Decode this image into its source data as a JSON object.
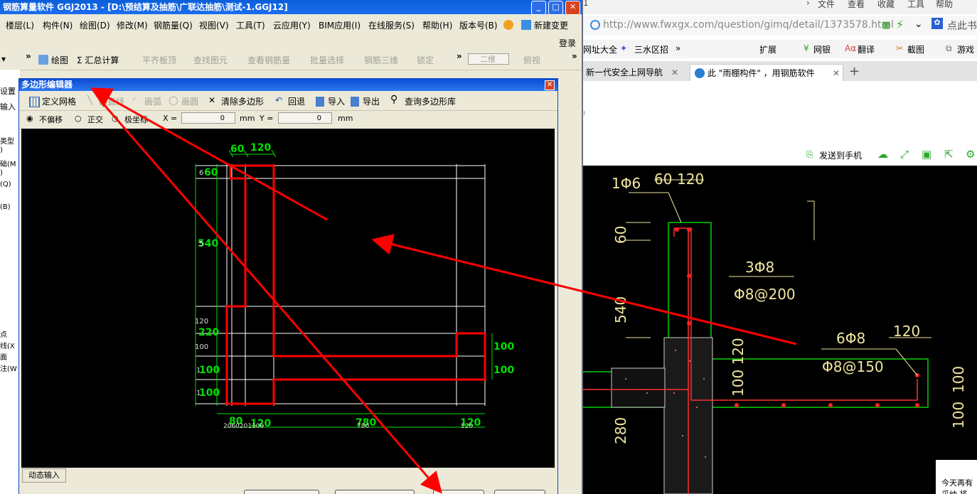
{
  "app": {
    "title": "钢筋算量软件 GGJ2013 - [D:\\预结算及抽筋\\广联达抽筋\\测试-1.GGJ12]",
    "window_buttons": [
      "_",
      "□",
      "✕"
    ],
    "menu": [
      "楼层(L)",
      "构件(N)",
      "绘图(D)",
      "修改(M)",
      "钢筋量(Q)",
      "视图(V)",
      "工具(T)",
      "云应用(Y)",
      "BIM应用(I)",
      "在线服务(S)",
      "帮助(H)",
      "版本号(B)",
      "新建变更"
    ],
    "login": "登录",
    "toolbar": {
      "draw": "绘图",
      "summary": "Σ 汇总计算",
      "flat_top": "平齐板顶",
      "find_element": "查找图元",
      "view_rebar": "查看钢筋量",
      "batch_select": "批量选择",
      "rebar_3d": "钢筋三维",
      "lock": "锁定",
      "view_mode": "二维",
      "top_view": "俯视"
    },
    "left_strip": {
      "settings": "设置",
      "input": "输入",
      "items": [
        "类型",
        ")",
        "础(M",
        ")",
        "(Q)",
        "(B)",
        "点",
        "线(X",
        "面",
        "注(W"
      ]
    }
  },
  "dialog": {
    "title": "多边形编辑器",
    "close": "✕",
    "tools": {
      "define_grid": "定义网格",
      "draw_line": "画直线",
      "draw_arc": "画弧",
      "draw_circle": "画圆",
      "clear_polygon": "清除多边形",
      "undo": "回退",
      "import": "导入",
      "export": "导出",
      "query_library": "查询多边形库"
    },
    "options": {
      "no_offset": "不偏移",
      "orthogonal": "正交",
      "polar": "极坐标",
      "x_label": "X =",
      "x_value": "0",
      "y_label": "Y =",
      "y_value": "0",
      "unit": "mm"
    },
    "dims": {
      "top_60": "60",
      "top_120": "120",
      "left_60": "60",
      "left_540": "540",
      "left_120": "120",
      "left_220": "220",
      "left_100a": "100",
      "left_100b": "100",
      "left_100c": "100",
      "right_100a": "100",
      "right_100b": "100",
      "bottom_80": "80",
      "bottom_120a": "120",
      "bottom_780": "780",
      "bottom_120b": "120",
      "bottom_small": "2060201100",
      "bottom_small_780": "780",
      "bottom_small_120": "120",
      "left_small_6": "6",
      "left_small_5": "5",
      "left_small_1a": "1",
      "left_small_1b": "1"
    },
    "dynamic_input": "动态输入"
  },
  "browser": {
    "menu": [
      "文件",
      "查看",
      "收藏",
      "工具",
      "帮助"
    ],
    "url": "http://www.fwxgx.com/question/gimq/detail/1373578.html",
    "url_domain": "fwxgx.com",
    "search_hint": "点此书",
    "favorites": [
      "网址大全",
      "三水区招",
      "扩展",
      "网银",
      "翻译",
      "截图",
      "游戏"
    ],
    "tabs": [
      "新一代安全上网导航",
      "此 \"雨棚构件\" ，用钢筋软件"
    ],
    "send_to_phone": "发送到手机",
    "notice_text": "今天再有",
    "notice_text2": "采纳 将"
  },
  "cad": {
    "labels": {
      "rebar_1": "1Φ6",
      "dim_60": "60",
      "dim_120_top": "120",
      "dim_60_v": "60",
      "dim_540": "540",
      "rebar_3": "3Φ8",
      "rebar_spacing_200": "Φ8@200",
      "rebar_6": "6Φ8",
      "dim_120_right": "120",
      "rebar_spacing_150": "Φ8@150",
      "dim_100_120": "100 120",
      "dim_280": "280",
      "dim_100_r1": "100",
      "dim_100_r2": "100"
    }
  },
  "colors": {
    "title_blue": "#0a5fd9",
    "shape_red": "#ff0000",
    "dim_green": "#00e000",
    "grid_white": "#ffffff",
    "cad_yellow": "#f0e6a0"
  }
}
